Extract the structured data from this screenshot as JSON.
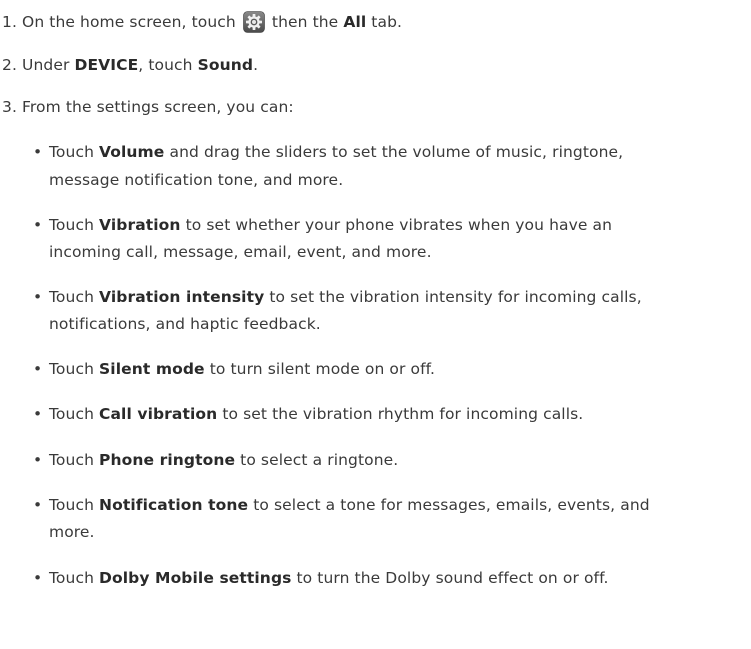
{
  "steps": [
    {
      "num": "1.",
      "pre": " On the home screen, touch ",
      "icon": "settings-gear-icon",
      "mid": " then the ",
      "bold": "All",
      "post": " tab."
    },
    {
      "num": "2.",
      "pre": " Under ",
      "bold1": "DEVICE",
      "mid": ", touch ",
      "bold2": "Sound",
      "post": "."
    },
    {
      "num": "3.",
      "text": " From the settings screen, you can:"
    }
  ],
  "bullet_symbol": "•",
  "bullets": [
    {
      "pre": "Touch ",
      "bold": "Volume",
      "line1": " and drag the sliders to set the volume of music, ringtone,",
      "line2": "message notification tone, and more."
    },
    {
      "pre": "Touch ",
      "bold": "Vibration",
      "line1": " to set whether your phone vibrates when you have an",
      "line2": "incoming call, message, email, event, and more."
    },
    {
      "pre": "Touch ",
      "bold": "Vibration intensity",
      "line1": " to set the vibration intensity for incoming calls,",
      "line2": "notifications, and haptic feedback."
    },
    {
      "pre": "Touch ",
      "bold": "Silent mode",
      "line1": " to turn silent mode on or off."
    },
    {
      "pre": "Touch ",
      "bold": "Call vibration",
      "line1": " to set the vibration rhythm for incoming calls."
    },
    {
      "pre": "Touch ",
      "bold": "Phone ringtone",
      "line1": " to select a ringtone."
    },
    {
      "pre": "Touch ",
      "bold": "Notification tone",
      "line1": " to select a tone for messages, emails, events, and",
      "line2": "more."
    },
    {
      "pre": "Touch ",
      "bold": "Dolby Mobile settings",
      "line1": " to turn the Dolby sound effect on or off."
    }
  ]
}
